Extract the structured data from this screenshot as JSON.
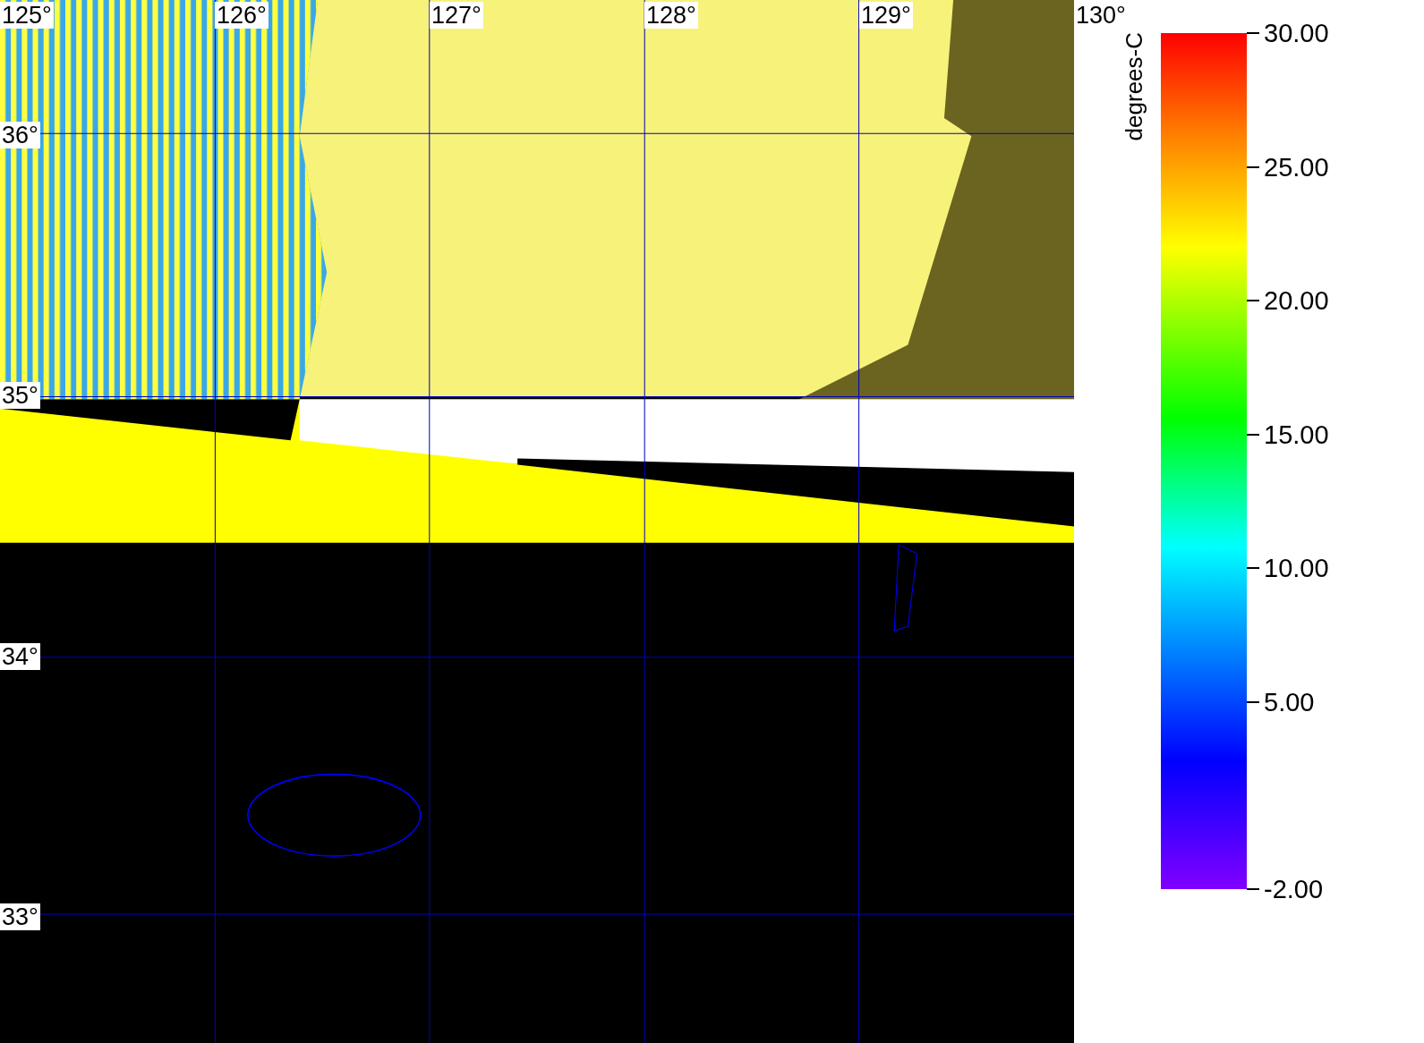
{
  "map": {
    "longitude_labels": [
      "125°",
      "126°",
      "127°",
      "128°",
      "129°",
      "130°"
    ],
    "latitude_labels": [
      "36°",
      "35°",
      "34°",
      "33°"
    ]
  },
  "legend": {
    "title": "degrees-C",
    "ticks": [
      "30.00",
      "25.00",
      "20.00",
      "15.00",
      "10.00",
      "5.00",
      "-2.00"
    ]
  }
}
